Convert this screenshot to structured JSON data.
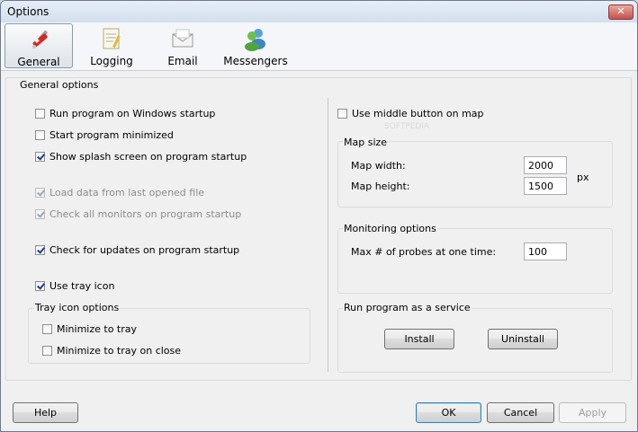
{
  "window": {
    "title": "Options",
    "close_symbol": "✕"
  },
  "tabs": [
    {
      "label": "General",
      "icon": "tools-icon",
      "active": true
    },
    {
      "label": "Logging",
      "icon": "notepad-icon",
      "active": false
    },
    {
      "label": "Email",
      "icon": "envelope-icon",
      "active": false
    },
    {
      "label": "Messengers",
      "icon": "users-icon",
      "active": false
    }
  ],
  "general": {
    "group_title": "General options",
    "run_on_startup": {
      "label": "Run program on Windows startup",
      "checked": false
    },
    "start_minimized": {
      "label": "Start program minimized",
      "checked": false
    },
    "show_splash": {
      "label": "Show splash screen on program startup",
      "checked": true
    },
    "load_last_file": {
      "label": "Load data from last opened file",
      "checked": true,
      "disabled": true
    },
    "check_monitors": {
      "label": "Check all monitors on program startup",
      "checked": true,
      "disabled": true
    },
    "check_updates": {
      "label": "Check for updates on program startup",
      "checked": true
    },
    "use_tray": {
      "label": "Use tray icon",
      "checked": true
    },
    "tray_group_title": "Tray icon options",
    "minimize_to_tray": {
      "label": "Minimize to tray",
      "checked": false
    },
    "minimize_on_close": {
      "label": "Minimize to tray on close",
      "checked": false
    }
  },
  "right": {
    "middle_button": {
      "label": "Use middle button on map",
      "checked": false
    },
    "watermark": "SOFTPEDIA",
    "map_size": {
      "title": "Map size",
      "width_label": "Map width:",
      "width_value": "2000",
      "height_label": "Map height:",
      "height_value": "1500",
      "unit": "px"
    },
    "monitoring": {
      "title": "Monitoring options",
      "probes_label": "Max # of probes at one time:",
      "probes_value": "100"
    },
    "service": {
      "title": "Run program as a service",
      "install": "Install",
      "uninstall": "Uninstall"
    }
  },
  "footer": {
    "help": "Help",
    "ok": "OK",
    "cancel": "Cancel",
    "apply": "Apply"
  }
}
